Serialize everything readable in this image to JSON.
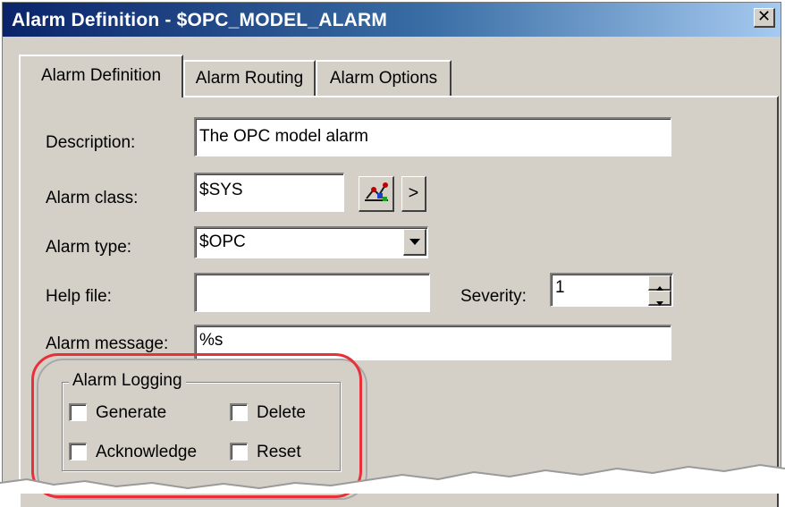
{
  "window": {
    "title": "Alarm Definition - $OPC_MODEL_ALARM",
    "close_glyph": "✕"
  },
  "tabs": [
    {
      "label": "Alarm Definition",
      "active": true
    },
    {
      "label": "Alarm Routing",
      "active": false
    },
    {
      "label": "Alarm Options",
      "active": false
    }
  ],
  "form": {
    "description": {
      "label": "Description:",
      "value": "The OPC model alarm"
    },
    "alarm_class": {
      "label": "Alarm class:",
      "value": "$SYS",
      "browse_button": ">"
    },
    "alarm_type": {
      "label": "Alarm type:",
      "value": "$OPC"
    },
    "help_file": {
      "label": "Help file:",
      "value": ""
    },
    "severity": {
      "label": "Severity:",
      "value": "1"
    },
    "alarm_message": {
      "label": "Alarm message:",
      "value": "%s"
    }
  },
  "alarm_logging": {
    "title": "Alarm Logging",
    "checkboxes": [
      {
        "label": "Generate",
        "checked": false
      },
      {
        "label": "Delete",
        "checked": false
      },
      {
        "label": "Acknowledge",
        "checked": false
      },
      {
        "label": "Reset",
        "checked": false
      }
    ]
  },
  "colors": {
    "titlebar_start": "#0a246a",
    "titlebar_end": "#a6caf0",
    "dialog_face": "#d4d0c8",
    "highlight_ring": "#e8303a"
  },
  "icons": {
    "alarm_class_picker": "alarm-class-picker-icon",
    "dropdown": "chevron-down-icon",
    "spin_up": "spin-up-icon",
    "spin_down": "spin-down-icon"
  }
}
